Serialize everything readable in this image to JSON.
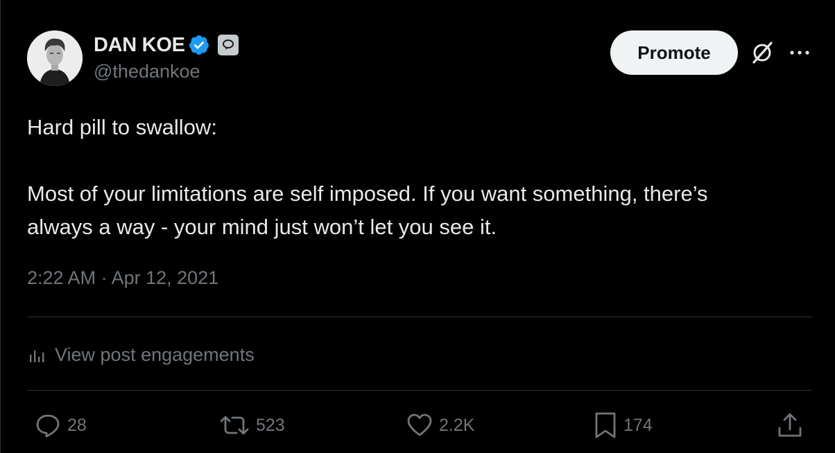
{
  "author": {
    "name": "DAN KOE",
    "handle": "@thedankoe",
    "avatar_icon": "profile-photo",
    "verified_color": "#1d9bf0"
  },
  "header": {
    "promote_label": "Promote"
  },
  "tweet": {
    "line1": "Hard pill to swallow:",
    "line2": "Most of your limitations are self imposed. If you want something, there’s",
    "line3": "always a way - your mind just won’t let you see it.",
    "timestamp": "2:22 AM · Apr 12, 2021"
  },
  "engagements": {
    "label": "View post engagements"
  },
  "actions": {
    "replies": "28",
    "reposts": "523",
    "likes": "2.2K",
    "bookmarks": "174"
  },
  "colors": {
    "background": "#000000",
    "text_primary": "#e7e9ea",
    "text_secondary": "#71767b",
    "divider": "#2f3336",
    "promote_bg": "#eff3f4"
  }
}
